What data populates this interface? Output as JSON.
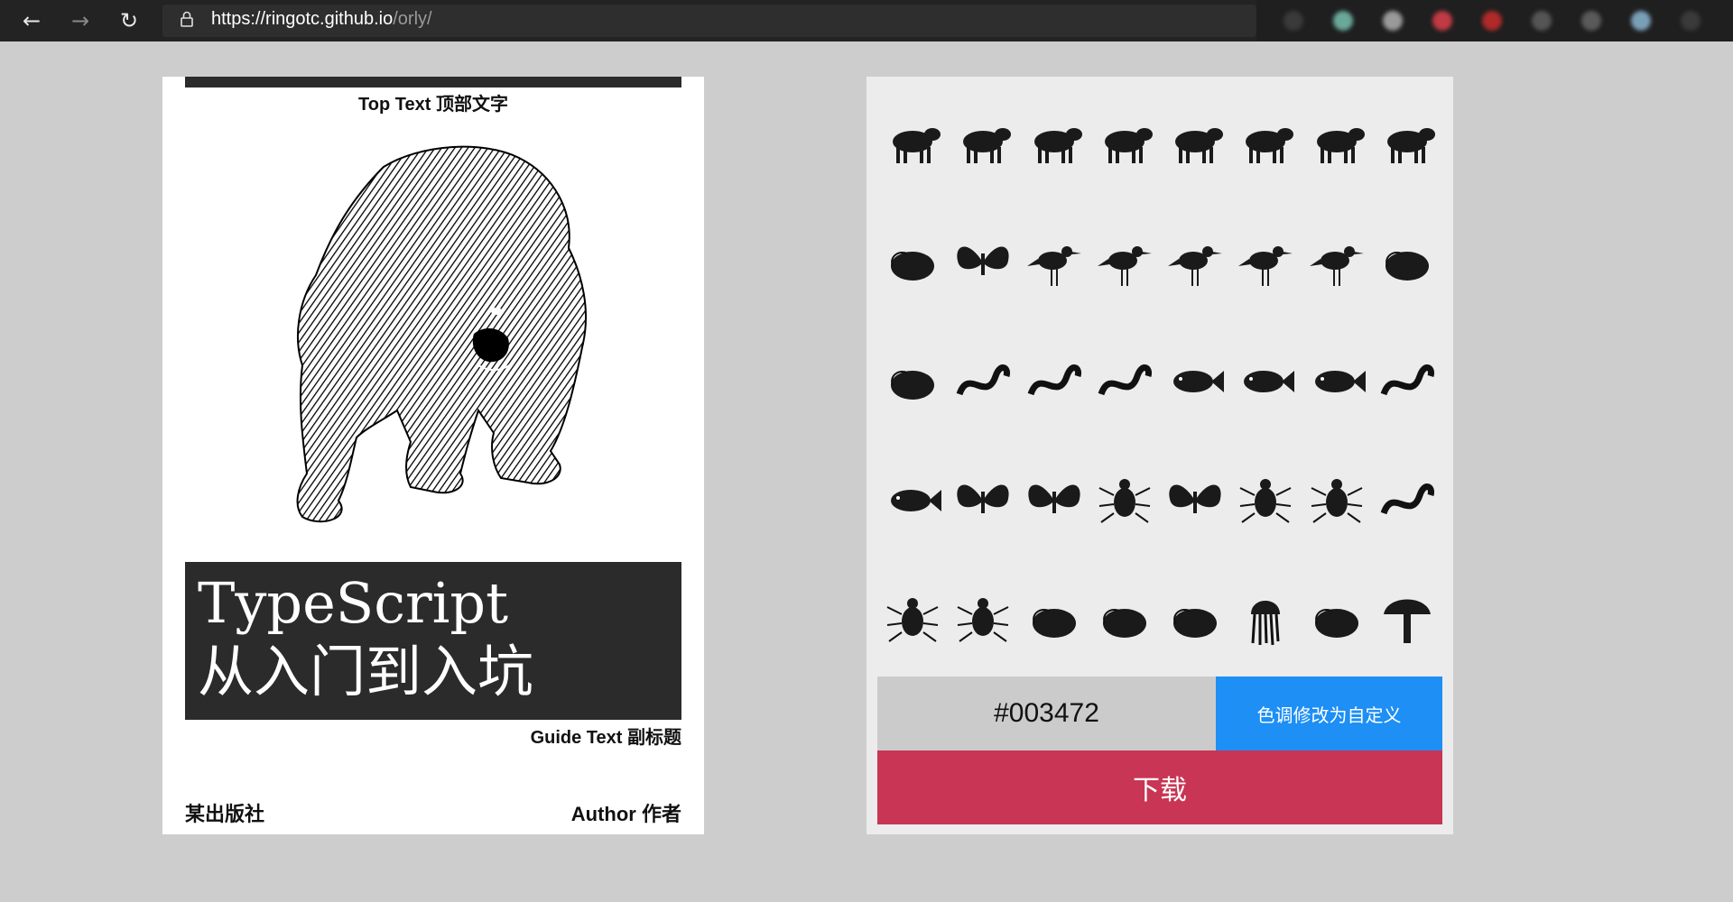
{
  "browser": {
    "back_icon": "arrow-left-icon",
    "forward_icon": "arrow-right-icon",
    "reload_icon": "reload-icon",
    "url_scheme": "https://",
    "url_host": "ringotc.github.io",
    "url_path": "/orly/",
    "extension_colors": [
      "#3a3a3a",
      "#6aa89a",
      "#9a9a9a",
      "#c23a44",
      "#b02a2a",
      "#555555",
      "#5a5a5a",
      "#7aa0b8",
      "#3a3a3a"
    ]
  },
  "cover": {
    "top_text": "Top Text 顶部文字",
    "title_line1": "TypeScript",
    "title_line2": "从入门到入坑",
    "guide_text": "Guide Text 副标题",
    "publisher": "某出版社",
    "author": "Author 作者",
    "image": "bear-illustration",
    "band_color": "#2b2b2b"
  },
  "picker": {
    "animals": [
      "bear",
      "raccoon",
      "wolf",
      "cow",
      "horse",
      "deer",
      "monkey",
      "wombat",
      "platypus",
      "bat",
      "pelican",
      "stork",
      "lapwing",
      "crow",
      "ostrich",
      "chameleon",
      "frog",
      "newt",
      "lizard",
      "snake",
      "catfish",
      "scorpionfish",
      "angelfish",
      "eel",
      "sunfish",
      "butterfly",
      "moth",
      "fly",
      "dragonfly",
      "beetle",
      "spider",
      "shrimp",
      "crab",
      "lobster",
      "horseshoe-crab",
      "isopod",
      "sea-slug",
      "jellyfish",
      "coral",
      "mushroom"
    ],
    "color_value": "#003472",
    "custom_button": "色调修改为自定义",
    "download_button": "下载",
    "custom_color": "#1d8ff5",
    "download_color": "#c93554"
  }
}
